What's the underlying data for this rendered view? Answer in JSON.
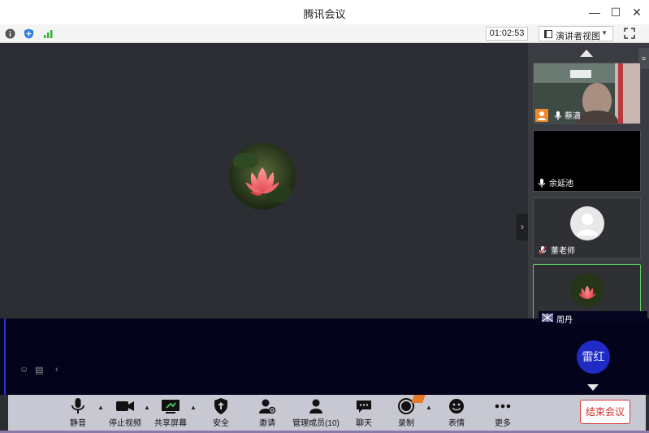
{
  "window": {
    "title": "腾讯会议",
    "minimize": "—",
    "maximize": "☐",
    "close": "✕"
  },
  "infobar": {
    "timer": "01:02:53",
    "view_label": "演讲者视图",
    "icons": [
      "info-icon",
      "shield-icon",
      "signal-icon",
      "fullscreen-icon"
    ]
  },
  "participants": [
    {
      "name": "蔡潇"
    },
    {
      "name": "余延池"
    },
    {
      "name": "董老师"
    },
    {
      "name": "周丹"
    }
  ],
  "overlay": {
    "leihong": "雷红"
  },
  "toolbar": {
    "mute": "静音",
    "stop_video": "停止视频",
    "share_screen": "共享屏幕",
    "security": "安全",
    "invite": "邀请",
    "manage_members": "管理成员(10)",
    "chat": "聊天",
    "record": "录制",
    "reactions": "表情",
    "more": "更多",
    "end_meeting": "结束会议"
  },
  "colors": {
    "accent_green": "#5ed35e",
    "end_red": "#d62f2f",
    "leihong_blue": "#1f2bc4"
  }
}
